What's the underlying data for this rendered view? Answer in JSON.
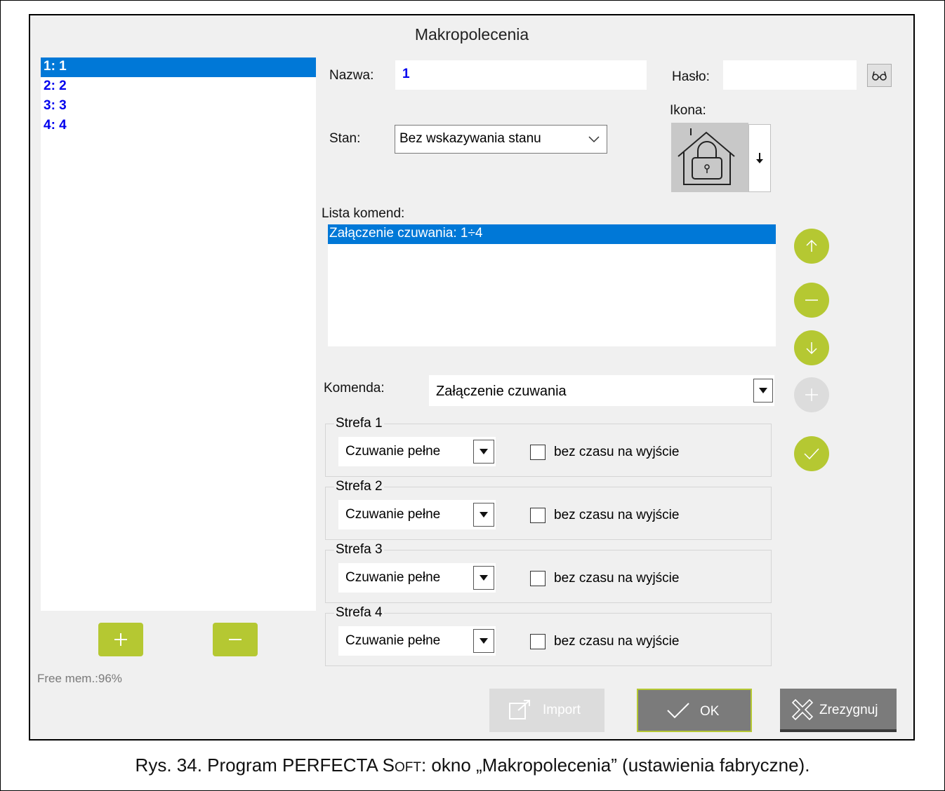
{
  "window": {
    "title": "Makropolecenia"
  },
  "macro_list": {
    "items": [
      {
        "label": "1: 1",
        "selected": true
      },
      {
        "label": "2: 2",
        "selected": false
      },
      {
        "label": "3: 3",
        "selected": false
      },
      {
        "label": "4: 4",
        "selected": false
      }
    ],
    "add_icon": "plus-icon",
    "remove_icon": "minus-icon",
    "free_mem": "Free mem.:96%"
  },
  "form": {
    "name_label": "Nazwa:",
    "name_value": "1",
    "password_label": "Hasło:",
    "password_value": "",
    "show_password_icon": "glasses-icon",
    "state_label": "Stan:",
    "state_value": "Bez wskazywania stanu",
    "icon_label": "Ikona:",
    "icon_name": "house-lock-icon",
    "command_list_label": "Lista komend:",
    "commands": [
      "Załączenie czuwania: 1÷4"
    ],
    "command_label": "Komenda:",
    "command_value": "Załączenie czuwania"
  },
  "side_buttons": [
    "up-arrow-icon",
    "minus-icon",
    "down-arrow-icon",
    "plus-icon",
    "check-icon"
  ],
  "zones": [
    {
      "title": "Strefa 1",
      "mode": "Czuwanie pełne",
      "checkbox_label": "bez czasu na wyjście",
      "checked": false
    },
    {
      "title": "Strefa 2",
      "mode": "Czuwanie pełne",
      "checkbox_label": "bez czasu na wyjście",
      "checked": false
    },
    {
      "title": "Strefa 3",
      "mode": "Czuwanie pełne",
      "checkbox_label": "bez czasu na wyjście",
      "checked": false
    },
    {
      "title": "Strefa 4",
      "mode": "Czuwanie pełne",
      "checkbox_label": "bez czasu na wyjście",
      "checked": false
    }
  ],
  "footer": {
    "import_label": "Import",
    "ok_label": "OK",
    "cancel_label": "Zrezygnuj"
  },
  "caption": {
    "prefix": "Rys. 34. Program PERFECTA S",
    "small_caps": "OFT",
    "suffix": ": okno „Makropolecenia” (ustawienia fabryczne)."
  },
  "colors": {
    "accent_green": "#b5c832",
    "selection_blue": "#0078d7",
    "list_text_blue": "#0000ee"
  }
}
